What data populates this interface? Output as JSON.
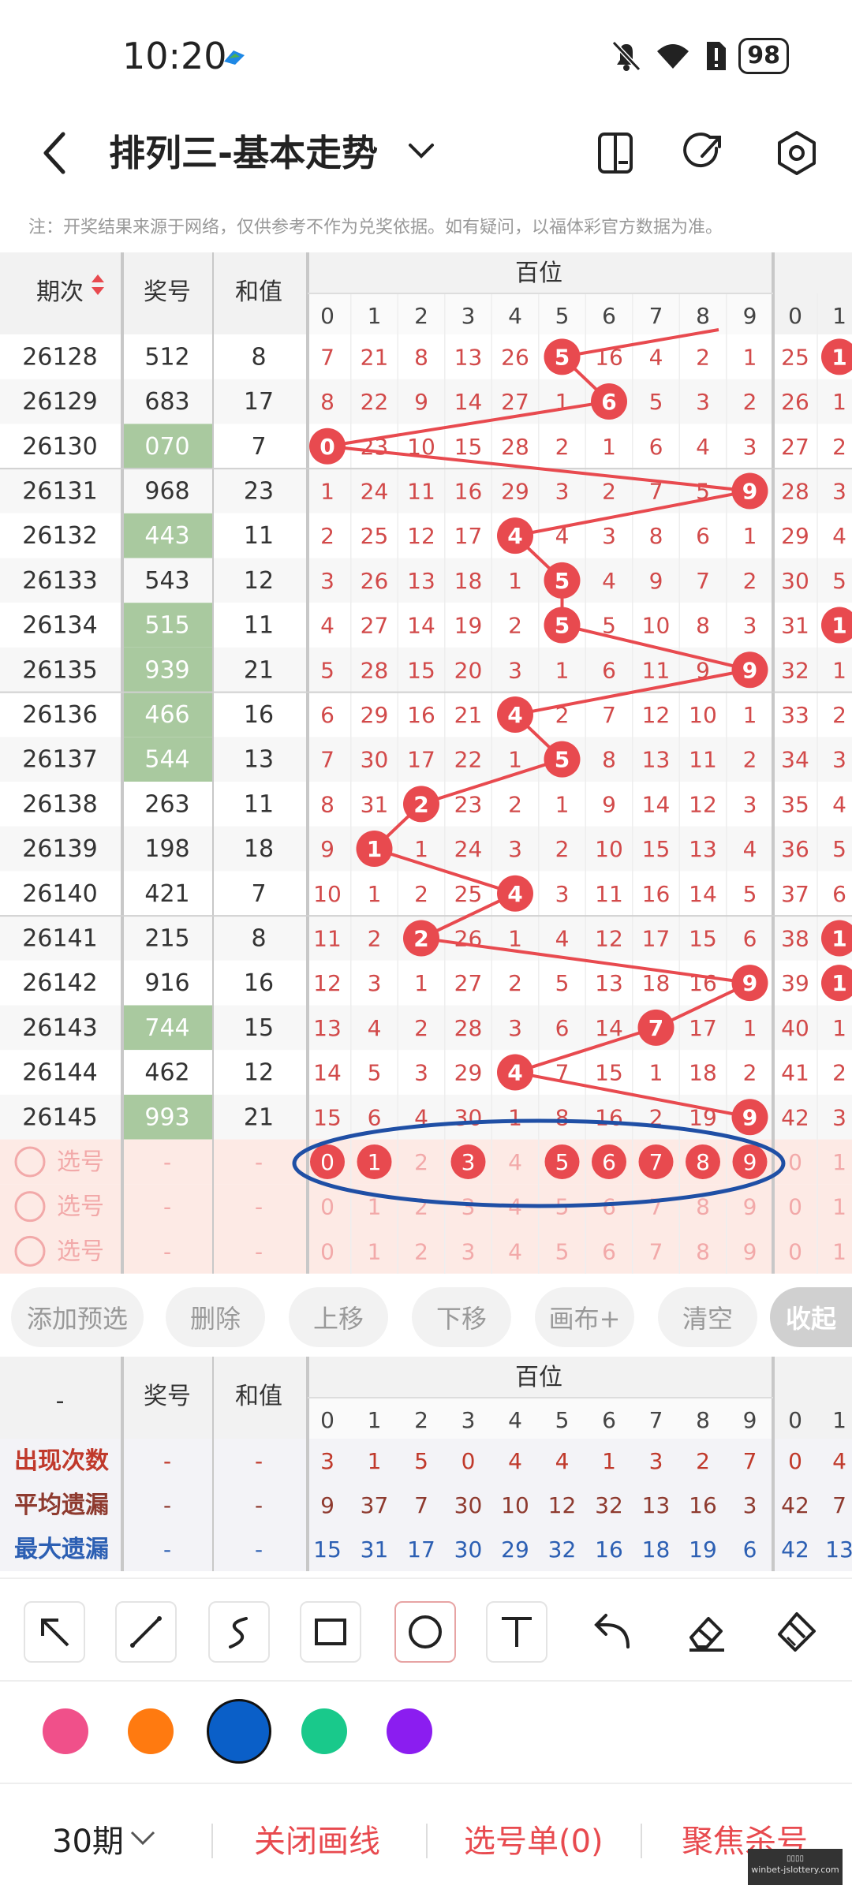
{
  "status_bar": {
    "time": "10:20",
    "battery": "98"
  },
  "header": {
    "title": "排列三-基本走势"
  },
  "notice": "注：开奖结果来源于网络，仅供参考不作为兑奖依据。如有疑问，以福体彩官方数据为准。",
  "table": {
    "headers": {
      "issue": "期次",
      "number": "奖号",
      "sum": "和值",
      "group": "百位",
      "digits": [
        "0",
        "1",
        "2",
        "3",
        "4",
        "5",
        "6",
        "7",
        "8",
        "9"
      ],
      "next_digits": [
        "0",
        "1"
      ]
    },
    "rows": [
      {
        "issue": "26128",
        "number": "512",
        "sum": "8",
        "hl": false,
        "hit": 5,
        "cells": [
          "7",
          "21",
          "8",
          "13",
          "26",
          "5",
          "16",
          "4",
          "2",
          "1"
        ],
        "next": [
          "25",
          "1"
        ],
        "next_hit": 1
      },
      {
        "issue": "26129",
        "number": "683",
        "sum": "17",
        "hl": false,
        "hit": 6,
        "cells": [
          "8",
          "22",
          "9",
          "14",
          "27",
          "1",
          "6",
          "5",
          "3",
          "2"
        ],
        "next": [
          "26",
          "1"
        ],
        "next_hit": -1
      },
      {
        "issue": "26130",
        "number": "070",
        "sum": "7",
        "hl": true,
        "hit": 0,
        "cells": [
          "0",
          "23",
          "10",
          "15",
          "28",
          "2",
          "1",
          "6",
          "4",
          "3"
        ],
        "next": [
          "27",
          "2"
        ],
        "next_hit": -1
      },
      {
        "issue": "26131",
        "number": "968",
        "sum": "23",
        "hl": false,
        "hit": 9,
        "cells": [
          "1",
          "24",
          "11",
          "16",
          "29",
          "3",
          "2",
          "7",
          "5",
          "9"
        ],
        "next": [
          "28",
          "3"
        ],
        "next_hit": -1
      },
      {
        "issue": "26132",
        "number": "443",
        "sum": "11",
        "hl": true,
        "hit": 4,
        "cells": [
          "2",
          "25",
          "12",
          "17",
          "4",
          "4",
          "3",
          "8",
          "6",
          "1"
        ],
        "next": [
          "29",
          "4"
        ],
        "next_hit": -1
      },
      {
        "issue": "26133",
        "number": "543",
        "sum": "12",
        "hl": false,
        "hit": 5,
        "cells": [
          "3",
          "26",
          "13",
          "18",
          "1",
          "5",
          "4",
          "9",
          "7",
          "2"
        ],
        "next": [
          "30",
          "5"
        ],
        "next_hit": -1
      },
      {
        "issue": "26134",
        "number": "515",
        "sum": "11",
        "hl": true,
        "hit": 5,
        "cells": [
          "4",
          "27",
          "14",
          "19",
          "2",
          "5",
          "5",
          "10",
          "8",
          "3"
        ],
        "next": [
          "31",
          "1"
        ],
        "next_hit": 1
      },
      {
        "issue": "26135",
        "number": "939",
        "sum": "21",
        "hl": true,
        "hit": 9,
        "cells": [
          "5",
          "28",
          "15",
          "20",
          "3",
          "1",
          "6",
          "11",
          "9",
          "9"
        ],
        "next": [
          "32",
          "1"
        ],
        "next_hit": -1
      },
      {
        "issue": "26136",
        "number": "466",
        "sum": "16",
        "hl": true,
        "hit": 4,
        "cells": [
          "6",
          "29",
          "16",
          "21",
          "4",
          "2",
          "7",
          "12",
          "10",
          "1"
        ],
        "next": [
          "33",
          "2"
        ],
        "next_hit": -1
      },
      {
        "issue": "26137",
        "number": "544",
        "sum": "13",
        "hl": true,
        "hit": 5,
        "cells": [
          "7",
          "30",
          "17",
          "22",
          "1",
          "5",
          "8",
          "13",
          "11",
          "2"
        ],
        "next": [
          "34",
          "3"
        ],
        "next_hit": -1
      },
      {
        "issue": "26138",
        "number": "263",
        "sum": "11",
        "hl": false,
        "hit": 2,
        "cells": [
          "8",
          "31",
          "2",
          "23",
          "2",
          "1",
          "9",
          "14",
          "12",
          "3"
        ],
        "next": [
          "35",
          "4"
        ],
        "next_hit": -1
      },
      {
        "issue": "26139",
        "number": "198",
        "sum": "18",
        "hl": false,
        "hit": 1,
        "cells": [
          "9",
          "1",
          "1",
          "24",
          "3",
          "2",
          "10",
          "15",
          "13",
          "4"
        ],
        "next": [
          "36",
          "5"
        ],
        "next_hit": -1
      },
      {
        "issue": "26140",
        "number": "421",
        "sum": "7",
        "hl": false,
        "hit": 4,
        "cells": [
          "10",
          "1",
          "2",
          "25",
          "4",
          "3",
          "11",
          "16",
          "14",
          "5"
        ],
        "next": [
          "37",
          "6"
        ],
        "next_hit": -1
      },
      {
        "issue": "26141",
        "number": "215",
        "sum": "8",
        "hl": false,
        "hit": 2,
        "cells": [
          "11",
          "2",
          "2",
          "26",
          "1",
          "4",
          "12",
          "17",
          "15",
          "6"
        ],
        "next": [
          "38",
          "1"
        ],
        "next_hit": 1
      },
      {
        "issue": "26142",
        "number": "916",
        "sum": "16",
        "hl": false,
        "hit": 9,
        "cells": [
          "12",
          "3",
          "1",
          "27",
          "2",
          "5",
          "13",
          "18",
          "16",
          "9"
        ],
        "next": [
          "39",
          "1"
        ],
        "next_hit": 1
      },
      {
        "issue": "26143",
        "number": "744",
        "sum": "15",
        "hl": true,
        "hit": 7,
        "cells": [
          "13",
          "4",
          "2",
          "28",
          "3",
          "6",
          "14",
          "7",
          "17",
          "1"
        ],
        "next": [
          "40",
          "1"
        ],
        "next_hit": -1
      },
      {
        "issue": "26144",
        "number": "462",
        "sum": "12",
        "hl": false,
        "hit": 4,
        "cells": [
          "14",
          "5",
          "3",
          "29",
          "4",
          "7",
          "15",
          "1",
          "18",
          "2"
        ],
        "next": [
          "41",
          "2"
        ],
        "next_hit": -1
      },
      {
        "issue": "26145",
        "number": "993",
        "sum": "21",
        "hl": true,
        "hit": 9,
        "cells": [
          "15",
          "6",
          "4",
          "30",
          "1",
          "8",
          "16",
          "2",
          "19",
          "9"
        ],
        "next": [
          "42",
          "3"
        ],
        "next_hit": -1
      }
    ],
    "select_rows": [
      {
        "label": "选号",
        "dash": "-",
        "cells": [
          "0",
          "1",
          "2",
          "3",
          "4",
          "5",
          "6",
          "7",
          "8",
          "9"
        ],
        "next": [
          "0",
          "1"
        ],
        "selected": [
          0,
          1,
          3,
          5,
          6,
          7,
          8,
          9
        ]
      },
      {
        "label": "选号",
        "dash": "-",
        "cells": [
          "0",
          "1",
          "2",
          "3",
          "4",
          "5",
          "6",
          "7",
          "8",
          "9"
        ],
        "next": [
          "0",
          "1"
        ],
        "selected": []
      },
      {
        "label": "选号",
        "dash": "-",
        "cells": [
          "0",
          "1",
          "2",
          "3",
          "4",
          "5",
          "6",
          "7",
          "8",
          "9"
        ],
        "next": [
          "0",
          "1"
        ],
        "selected": []
      }
    ]
  },
  "buttons": [
    "添加预选",
    "删除",
    "上移",
    "下移",
    "画布+",
    "清空",
    "收起"
  ],
  "stats": {
    "headers": {
      "first": "-",
      "number": "奖号",
      "sum": "和值",
      "group": "百位"
    },
    "rows": [
      {
        "label": "出现次数",
        "dash1": "-",
        "dash2": "-",
        "cells": [
          "3",
          "1",
          "5",
          "0",
          "4",
          "4",
          "1",
          "3",
          "2",
          "7"
        ],
        "next": [
          "0",
          "4"
        ],
        "color": "#c0392b"
      },
      {
        "label": "平均遗漏",
        "dash1": "-",
        "dash2": "-",
        "cells": [
          "9",
          "37",
          "7",
          "30",
          "10",
          "12",
          "32",
          "13",
          "16",
          "3"
        ],
        "next": [
          "42",
          "7"
        ],
        "color": "#8e3a2f"
      },
      {
        "label": "最大遗漏",
        "dash1": "-",
        "dash2": "-",
        "cells": [
          "15",
          "31",
          "17",
          "30",
          "29",
          "32",
          "16",
          "18",
          "19",
          "6"
        ],
        "next": [
          "42",
          "13"
        ],
        "color": "#2c5fb3"
      }
    ]
  },
  "colors": {
    "hit": "#e84a4f",
    "line": "#e84a4f",
    "highlight": "#a9c99f",
    "select_bg": "#fdeae5",
    "ellipse": "#1f4fa5",
    "swatches": [
      "#f0508a",
      "#ff7a10",
      "#0a5fc8",
      "#19c98b",
      "#8b1df0"
    ]
  },
  "tools": [
    "pointer-arrow-icon",
    "line-icon",
    "curve-icon",
    "rectangle-icon",
    "circle-icon",
    "text-icon",
    "undo-icon",
    "eraser-icon",
    "clear-brush-icon"
  ],
  "bottom_nav": {
    "period": "30期",
    "close_line": "关闭画线",
    "ticket": "选号单(0)",
    "focus": "聚焦杀号"
  },
  "watermark": "winbet-jslottery.com"
}
